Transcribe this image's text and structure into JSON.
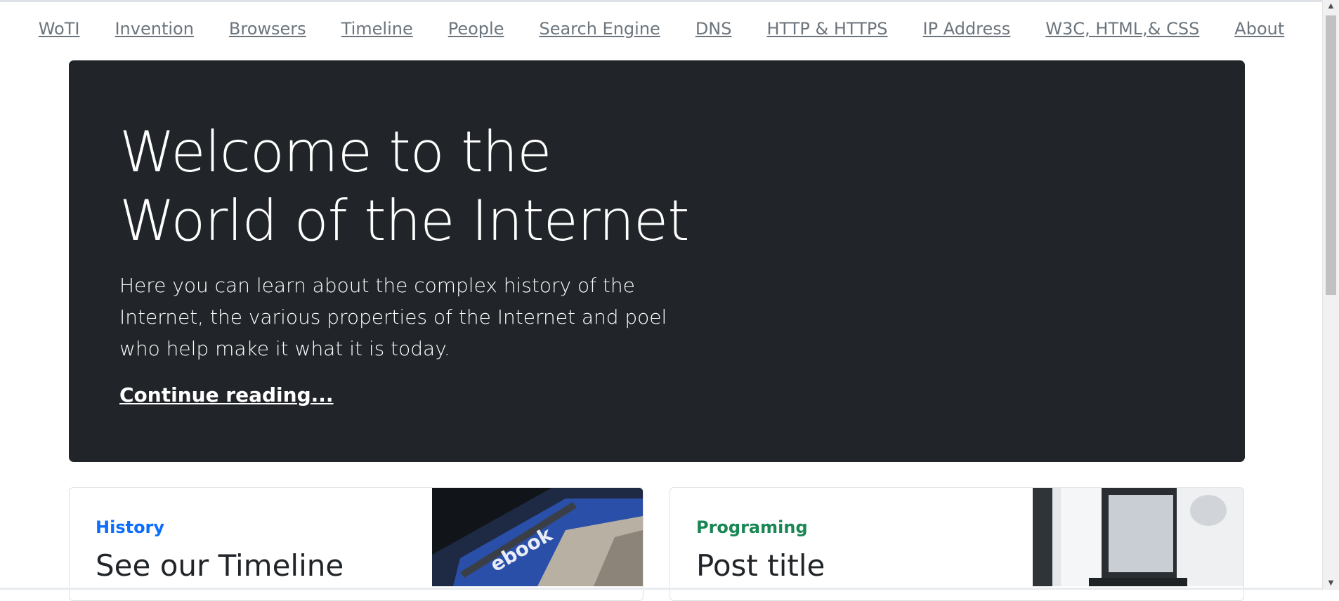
{
  "nav": {
    "items": [
      {
        "label": "WoTI"
      },
      {
        "label": "Invention"
      },
      {
        "label": "Browsers"
      },
      {
        "label": "Timeline"
      },
      {
        "label": "People"
      },
      {
        "label": "Search Engine"
      },
      {
        "label": "DNS"
      },
      {
        "label": "HTTP & HTTPS"
      },
      {
        "label": "IP Address"
      },
      {
        "label": "W3C, HTML,& CSS"
      },
      {
        "label": "About"
      }
    ]
  },
  "hero": {
    "title_line1": "Welcome to the",
    "title_line2": "World of the Internet",
    "lead": "Here you can learn about the complex history of the Internet, the various properties of the Internet and poel who help make it what it is today.",
    "link": "Continue reading..."
  },
  "cards": [
    {
      "category": "History",
      "category_color": "#0d6efd",
      "title": "See our Timeline"
    },
    {
      "category": "Programing",
      "category_color": "#198754",
      "title": "Post title"
    }
  ],
  "colors": {
    "hero_bg": "#212529",
    "nav_link": "#6c757d"
  }
}
